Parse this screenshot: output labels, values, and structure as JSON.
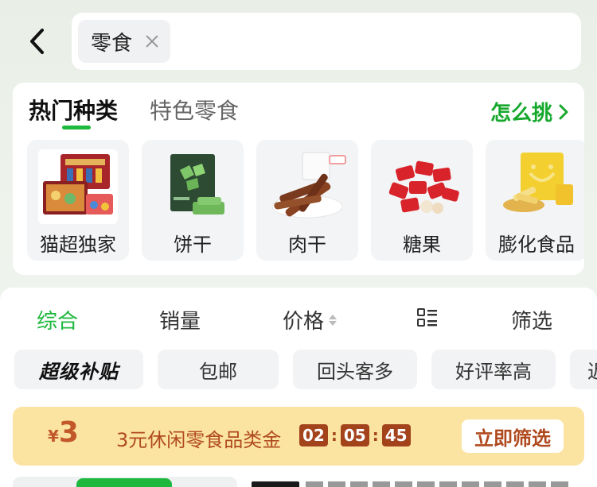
{
  "header": {
    "search_chip_text": "零食"
  },
  "categories": {
    "tabs": [
      "热门种类",
      "特色零食"
    ],
    "how_to_pick": "怎么挑",
    "items": [
      {
        "label": "猫超独家",
        "icon": "gift-box-image"
      },
      {
        "label": "饼干",
        "icon": "biscuit-image"
      },
      {
        "label": "肉干",
        "icon": "jerky-image"
      },
      {
        "label": "糖果",
        "icon": "candy-image"
      },
      {
        "label": "膨化食品",
        "icon": "puffed-snack-image"
      }
    ]
  },
  "sort": {
    "items": [
      "综合",
      "销量",
      "价格",
      "筛选"
    ],
    "active": "综合",
    "view_icon": "list-view-icon"
  },
  "filters": {
    "chips": [
      "超级补贴",
      "包邮",
      "回头客多",
      "好评率高",
      "近"
    ]
  },
  "coupon": {
    "currency": "¥",
    "amount": "3",
    "description": "3元休闲零食品类金",
    "timer": [
      "02",
      "05",
      "45"
    ],
    "button": "立即筛选"
  },
  "colors": {
    "accent_green": "#1db83d",
    "coupon_bg": "#fbe3a2",
    "coupon_text": "#b04a1e"
  }
}
